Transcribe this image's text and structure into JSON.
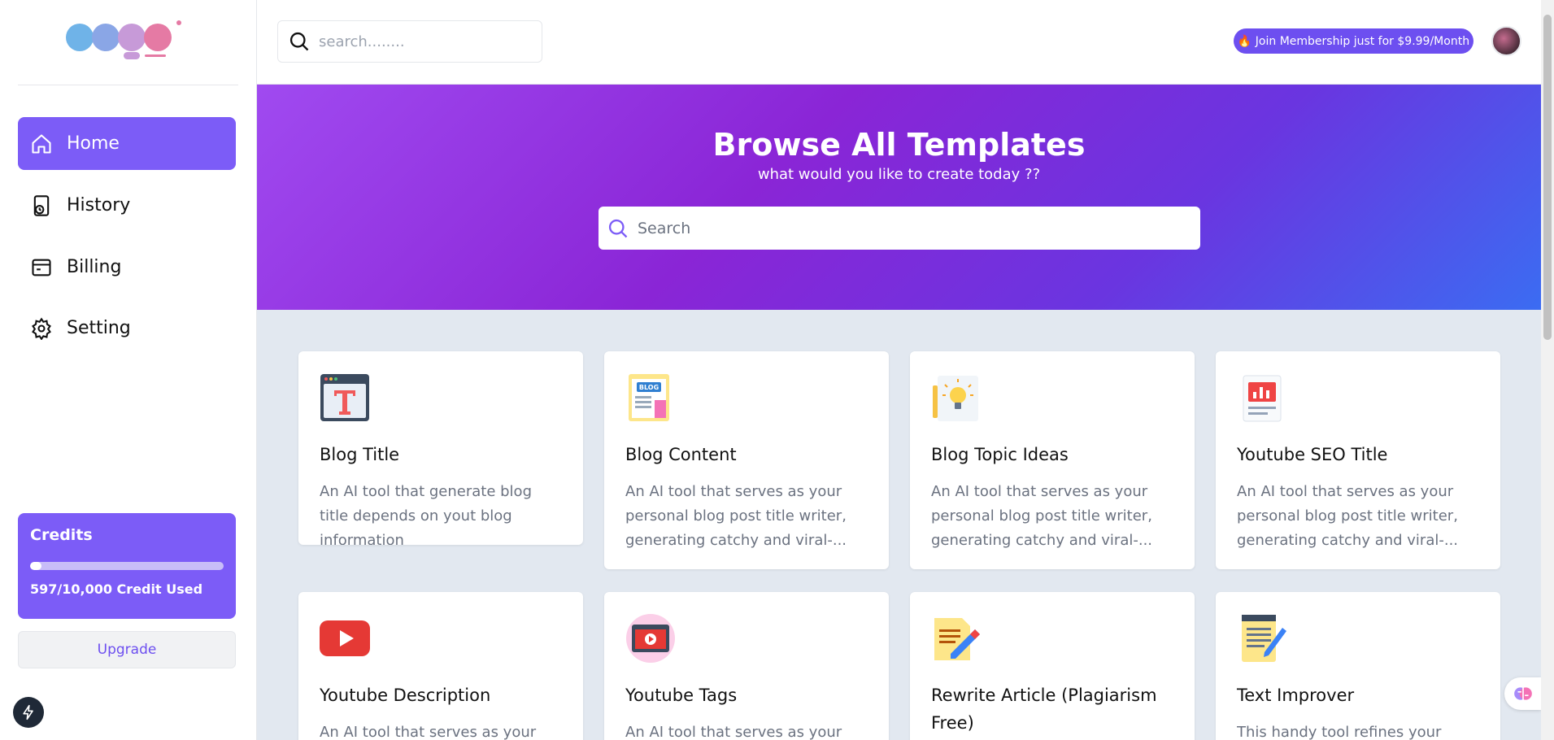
{
  "sidebar": {
    "nav": [
      {
        "label": "Home",
        "icon": "home-icon",
        "active": true
      },
      {
        "label": "History",
        "icon": "history-icon",
        "active": false
      },
      {
        "label": "Billing",
        "icon": "billing-icon",
        "active": false
      },
      {
        "label": "Setting",
        "icon": "gear-icon",
        "active": false
      }
    ],
    "credits": {
      "title": "Credits",
      "used_text": "597/10,000 Credit Used",
      "used_fraction": 0.0597
    },
    "upgrade_label": "Upgrade"
  },
  "header": {
    "search_placeholder": "search........",
    "membership_label": "🔥 Join Membership just for $9.99/Month"
  },
  "hero": {
    "title": "Browse All Templates",
    "subtitle": "what would you like to create today ??",
    "search_placeholder": "Search"
  },
  "templates": [
    {
      "title": "Blog Title",
      "desc": "An AI tool that generate blog title depends on yout blog information",
      "icon": "blog-title-icon"
    },
    {
      "title": "Blog Content",
      "desc": "An AI tool that serves as your personal blog post title writer, generating catchy and viral-...",
      "icon": "blog-content-icon"
    },
    {
      "title": "Blog Topic Ideas",
      "desc": "An AI tool that serves as your personal blog post title writer, generating catchy and viral-...",
      "icon": "lightbulb-icon"
    },
    {
      "title": "Youtube SEO Title",
      "desc": "An AI tool that serves as your personal blog post title writer, generating catchy and viral-...",
      "icon": "seo-chart-icon"
    },
    {
      "title": "Youtube Description",
      "desc": "An AI tool that serves as your",
      "icon": "youtube-icon"
    },
    {
      "title": "Youtube Tags",
      "desc": "An AI tool that serves as your",
      "icon": "video-tags-icon"
    },
    {
      "title": "Rewrite Article (Plagiarism Free)",
      "desc": "",
      "icon": "rewrite-icon"
    },
    {
      "title": "Text Improver",
      "desc": "This handy tool refines your",
      "icon": "notepad-icon"
    }
  ],
  "colors": {
    "accent": "#7c5cf7",
    "hero_start": "#a04af0",
    "hero_end": "#3b6cf2"
  }
}
